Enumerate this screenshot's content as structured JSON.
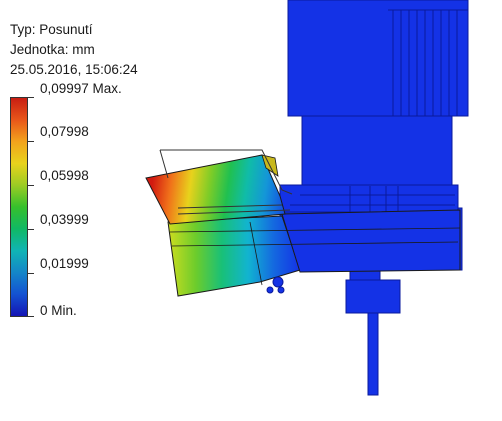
{
  "header": {
    "type_label": "Typ: Posunutí",
    "unit_label": "Jednotka: mm",
    "timestamp": "25.05.2016, 15:06:24"
  },
  "legend": {
    "colors": [
      "#c81e12",
      "#e8561a",
      "#f2a31c",
      "#e8d21c",
      "#9ccc24",
      "#36c02c",
      "#10b864",
      "#10b4b4",
      "#1486c8",
      "#1452d2",
      "#1414b4"
    ],
    "labels": [
      {
        "text": "0,09997 Max."
      },
      {
        "text": "0,07998"
      },
      {
        "text": "0,05998"
      },
      {
        "text": "0,03999"
      },
      {
        "text": "0,01999"
      },
      {
        "text": "0 Min."
      }
    ]
  },
  "model": {
    "base_color": "#1432e6",
    "dark_color": "#0a1a9c"
  }
}
